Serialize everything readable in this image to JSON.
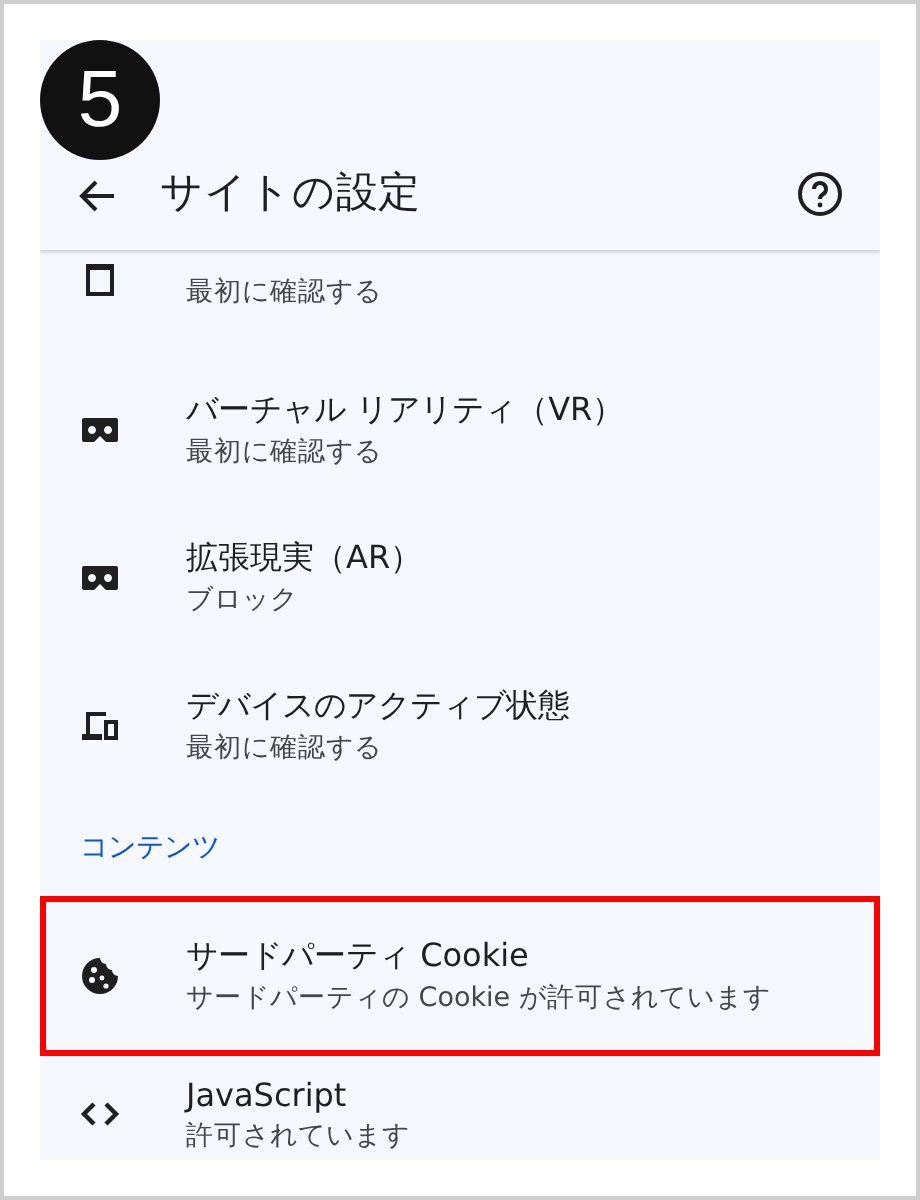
{
  "step_badge": "5",
  "header": {
    "title": "サイトの設定"
  },
  "items": [
    {
      "kind": "clipboard",
      "subtitle": "最初に確認する",
      "highlighted": false
    },
    {
      "kind": "vr",
      "title": "バーチャル リアリティ（VR）",
      "subtitle": "最初に確認する",
      "highlighted": false
    },
    {
      "kind": "vr",
      "title": "拡張現実（AR）",
      "subtitle": "ブロック",
      "highlighted": false
    },
    {
      "kind": "devices",
      "title": "デバイスのアクティブ状態",
      "subtitle": "最初に確認する",
      "highlighted": false
    },
    {
      "kind": "section",
      "title": "コンテンツ"
    },
    {
      "kind": "cookie",
      "title": "サードパーティ Cookie",
      "subtitle": "サードパーティの Cookie が許可されています",
      "highlighted": true
    },
    {
      "kind": "code",
      "title": "JavaScript",
      "subtitle": "許可されています",
      "highlighted": false
    }
  ]
}
